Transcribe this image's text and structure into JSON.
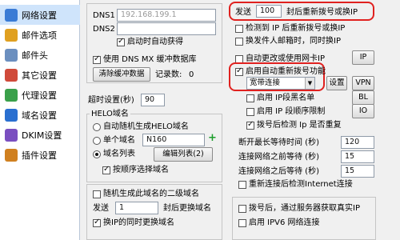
{
  "sidebar": {
    "items": [
      {
        "label": "网络设置",
        "icon": "network-icon",
        "color": "#3a7bd5",
        "selected": true
      },
      {
        "label": "邮件选项",
        "icon": "mail-options-icon",
        "color": "#e0a020"
      },
      {
        "label": "邮件头",
        "icon": "mail-header-icon",
        "color": "#6b8fbf"
      },
      {
        "label": "其它设置",
        "icon": "other-settings-icon",
        "color": "#d04a3a"
      },
      {
        "label": "代理设置",
        "icon": "proxy-icon",
        "color": "#3aa04a"
      },
      {
        "label": "域名设置",
        "icon": "domain-icon",
        "color": "#2a6fd0"
      },
      {
        "label": "DKIM设置",
        "icon": "dkim-icon",
        "color": "#7a4fc0"
      },
      {
        "label": "插件设置",
        "icon": "plugin-icon",
        "color": "#d08020"
      }
    ]
  },
  "dns": {
    "dns1_label": "DNS1",
    "dns1_value": "192.168.199.1",
    "dns2_label": "DNS2",
    "dns2_value": "",
    "auto_get_label": "启动时自动获得",
    "use_mx_cache_label": "使用 DNS MX 缓冲数据库",
    "clear_cache_button": "清除缓冲数据",
    "record_count_label": "记录数:",
    "record_count_value": "0"
  },
  "timeout": {
    "label": "超时设置(秒)",
    "value": "90"
  },
  "helo": {
    "title": "HELO域名",
    "auto_random_label": "自动随机生成HELO域名",
    "single_domain_label": "单个域名",
    "single_domain_value": "N160",
    "domain_list_label": "域名列表",
    "edit_list_button": "编辑列表(2)",
    "select_in_order_label": "按顺序选择域名"
  },
  "second_level": {
    "random_label": "随机生成此域名的二级域名",
    "send_label": "发送",
    "send_value": "1",
    "then_switch_label": "封后更换域名",
    "ip_same_label": "换IP的同时更换域名"
  },
  "right": {
    "send_label": "发送",
    "send_value": "100",
    "redial_label": "封后重新拨号或换IP",
    "check_ip_label": "检测到 IP 后重新拨号或换IP",
    "switch_user_label": "换发件人邮箱时，同时换IP",
    "auto_nic_label": "自动更改或使用网卡IP",
    "ip_button": "IP",
    "auto_redial_label": "启用自动重新拨号功能",
    "broadband_select": "宽带连接",
    "settings_button": "设置",
    "vpn_button": "VPN",
    "ip_blacklist_label": "启用 IP段黑名单",
    "bl_button": "BL",
    "ip_order_label": "启用 IP 段顺序限制",
    "io_button": "IO",
    "check_dup_label": "拨号后检测 Ip 是否重复",
    "max_wait_label": "断开最长等待时间 (秒)",
    "max_wait_value": "120",
    "connect_before_label": "连接网络之前等待 (秒)",
    "connect_before_value": "15",
    "connect_after_label": "连接网络之后等待 (秒)",
    "connect_after_value": "15",
    "recheck_label": "重新连接后检测Internet连接",
    "after_dial_label": "拨号后，通过服务器获取真实IP",
    "ipv6_label": "启用 IPV6 网络连接"
  },
  "colors": {
    "highlight_border": "#e0211f",
    "selected_bg": "#cfe4fb"
  }
}
